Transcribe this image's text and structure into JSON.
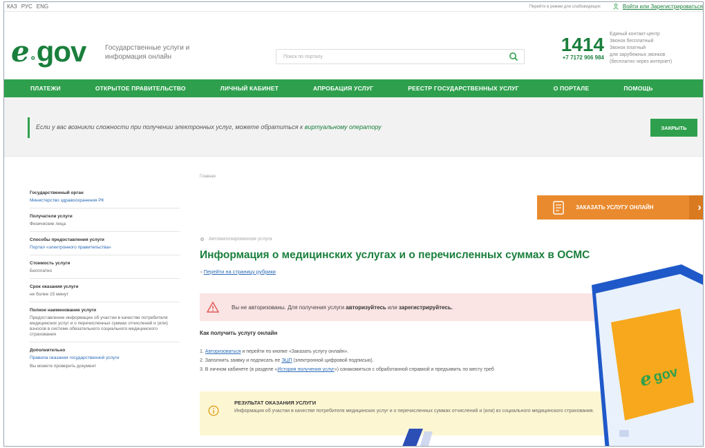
{
  "topbar": {
    "languages": [
      "КАЗ",
      "РУС",
      "ENG"
    ],
    "low_vision": "Перейти в режим для слабовидящих",
    "login": "Войти или Зарегистрироваться"
  },
  "header": {
    "logo_e": "e",
    "logo_gov": "gov",
    "tagline": "Государственные услуги и информация онлайн",
    "search_placeholder": "Поиск по порталу",
    "hotline_number": "1414",
    "hotline_phone": "+7 7172 906 984",
    "hotline_info": [
      "Единый контакт-центр",
      "Звонок бесплатный",
      "Звонок платный",
      "для зарубежных звонков",
      "(бесплатно через интернет)"
    ]
  },
  "nav": {
    "items": [
      "ПЛАТЕЖИ",
      "ОТКРЫТОЕ ПРАВИТЕЛЬСТВО",
      "ЛИЧНЫЙ КАБИНЕТ",
      "АПРОБАЦИЯ УСЛУГ",
      "РЕЕСТР ГОСУДАРСТВЕННЫХ УСЛУГ",
      "О ПОРТАЛЕ",
      "ПОМОЩЬ"
    ]
  },
  "notice": {
    "text": "Если у вас возникли сложности при получении электронных услуг, можете обратиться к ",
    "link": "виртуальному оператору",
    "close": "ЗАКРЫТЬ"
  },
  "sidebar": {
    "sections": [
      {
        "label": "Государственный орган",
        "value": "Министерство здравоохранения РК",
        "link": true
      },
      {
        "label": "Получатели услуги",
        "value": "Физические лица",
        "link": false
      },
      {
        "label": "Способы предоставления услуги",
        "value": "Портал «электронного правительства»",
        "link": true
      },
      {
        "label": "Стоимость услуги",
        "value": "Бесплатно",
        "link": false
      },
      {
        "label": "Срок оказания услуги",
        "value": "не более 15 минут",
        "link": false
      },
      {
        "label": "Полное наименование услуги",
        "value": "Предоставление информации об участии в качестве потребителя медицинских услуг и о перечисленных суммах отчислений и (или) взносов в системе обязательного социального медицинского страхования",
        "link": false
      },
      {
        "label": "Дополнительно",
        "value": "Правила оказания государственной услуги",
        "link": true,
        "value2": "Вы можете проверить документ"
      }
    ]
  },
  "main": {
    "breadcrumb": "Главная",
    "order_button": "ЗАКАЗАТЬ УСЛУГУ ОНЛАЙН",
    "service_type": "Автоматизированная услуга",
    "title": "Информация о медицинских услугах и о перечисленных суммах в ОСМС",
    "back_link": "Перейти на страницу рубрики",
    "alert_prefix": "Вы не авторизованы. Для получения услуги ",
    "alert_login": "авторизуйтесь",
    "alert_or": " или ",
    "alert_register": "зарегистрируйтесь.",
    "howto_title": "Как получить услугу онлайн",
    "step1_num": "1. ",
    "step1_link": "Авторизоваться",
    "step1_rest": " и перейти по кнопке «Заказать услугу онлайн».",
    "step2_text": "2. Заполнить заявку и подписать ее ",
    "step2_link": "ЭЦП",
    "step2_rest": " (электронной цифровой подписью).",
    "step3_text": "3. В личном кабинете (в разделе «",
    "step3_link": "История получения услуг",
    "step3_rest": "») ознакомиться с обработанной справкой и предъявить по месту треб",
    "result_title": "РЕЗУЛЬТАТ ОКАЗАНИЯ УСЛУГИ",
    "result_desc": "Информация об участии в качестве потребителя медицинских услуг и о перечисленных суммах отчислений и (или) вз социального медицинского страхования."
  },
  "colors": {
    "brand_green": "#2ea04d",
    "orange": "#ea8a2e",
    "alert_bg": "#fbe4e4",
    "result_bg": "#fdf6d2"
  }
}
